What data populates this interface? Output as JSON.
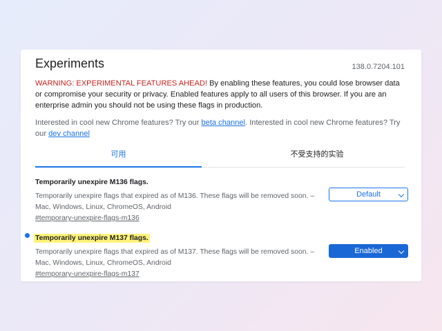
{
  "header": {
    "title": "Experiments",
    "version": "138.0.7204.101"
  },
  "warning": {
    "prefix": "WARNING: EXPERIMENTAL FEATURES AHEAD!",
    "body": " By enabling these features, you could lose browser data or compromise your security or privacy. Enabled features apply to all users of this browser. If you are an enterprise admin you should not be using these flags in production."
  },
  "interest": {
    "text1": "Interested in cool new Chrome features? Try our ",
    "link1": "beta channel",
    "text2": ". Interested in cool new Chrome features? Try our ",
    "link2": "dev channel"
  },
  "tabs": [
    {
      "label": "可用",
      "active": true
    },
    {
      "label": "不受支持的实验",
      "active": false
    }
  ],
  "flags": [
    {
      "title": "Temporarily unexpire M136 flags.",
      "description": "Temporarily unexpire flags that expired as of M136. These flags will be removed soon. – Mac, Windows, Linux, ChromeOS, Android",
      "link": "#temporary-unexpire-flags-m136",
      "selected": "Default",
      "highlighted": false
    },
    {
      "title": "Temporarily unexpire M137 flags.",
      "description": "Temporarily unexpire flags that expired as of M137. These flags will be removed soon. – Mac, Windows, Linux, ChromeOS, Android",
      "link": "#temporary-unexpire-flags-m137",
      "selected": "Enabled",
      "highlighted": true
    }
  ],
  "colors": {
    "accent": "#1a73e8",
    "warning": "#c5221f",
    "highlight": "#fff37a"
  }
}
